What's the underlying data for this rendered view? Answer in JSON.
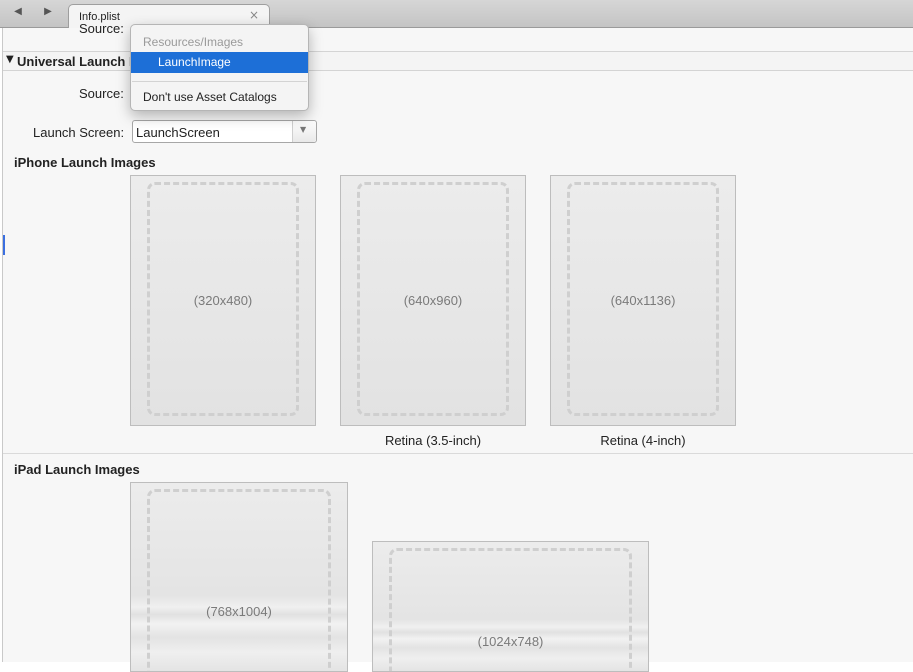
{
  "tab": {
    "title": "Info.plist",
    "close_glyph": "×",
    "back_glyph": "◀",
    "forward_glyph": "▶"
  },
  "section": {
    "title_visible": "Universal Launch I",
    "truncated_source_label": "Source:",
    "disclosure_glyph": "▼"
  },
  "fields": {
    "source_label": "Source:",
    "launch_screen_label": "Launch Screen:",
    "launch_screen_value": "LaunchScreen",
    "dropdown_glyph": "▼"
  },
  "popup_menu": {
    "header": "Resources/Images",
    "selected": "LaunchImage",
    "option": "Don't use Asset Catalogs"
  },
  "iphone": {
    "heading": "iPhone Launch Images",
    "slots": [
      {
        "size": "(320x480)",
        "caption": ""
      },
      {
        "size": "(640x960)",
        "caption": "Retina (3.5-inch)"
      },
      {
        "size": "(640x1136)",
        "caption": "Retina (4-inch)"
      }
    ]
  },
  "ipad": {
    "heading": "iPad Launch Images",
    "slots": [
      {
        "size": "(768x1004)"
      },
      {
        "size": "(1024x748)"
      }
    ]
  },
  "colors": {
    "selection": "#1d6fd7",
    "accent_marker": "#3b6fe0"
  },
  "icons": {
    "back": "chevron-left-icon",
    "forward": "chevron-right-icon",
    "close": "close-icon",
    "disclosure": "disclosure-triangle-icon",
    "dropdown": "dropdown-arrow-icon"
  }
}
